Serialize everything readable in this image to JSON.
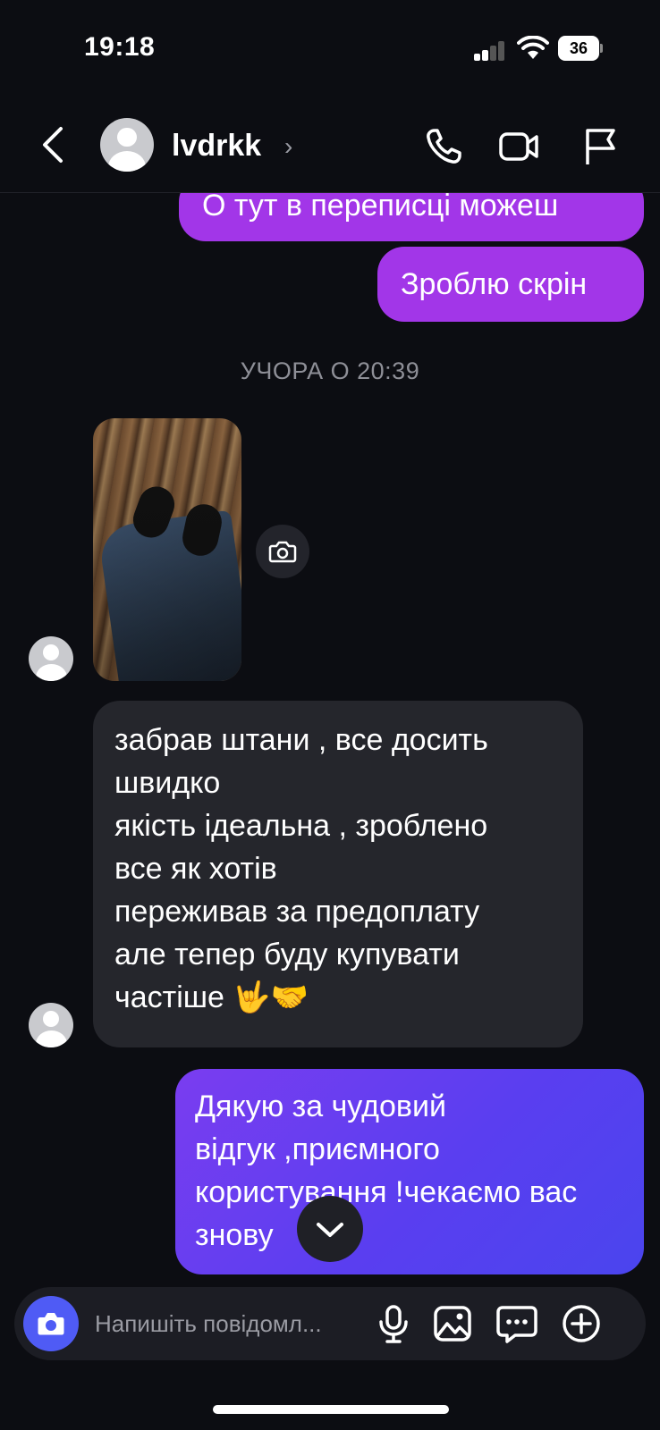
{
  "status_bar": {
    "time": "19:18",
    "battery": "36"
  },
  "header": {
    "username": "lvdrkk",
    "chevron": "›"
  },
  "messages": {
    "out1": "О тут в переписці можеш",
    "out2": "Зроблю скрін",
    "timestamp": "УЧОРА О 20:39",
    "in_text_lines": [
      "забрав штани , все досить",
      "швидко",
      "якість ідеальна , зроблено",
      "все як хотів",
      "переживав за предоплату",
      "але тепер буду купувати",
      "частіше 🤟🤝"
    ],
    "reply_lines": [
      "Дякую за чудовий",
      "відгук ,приємного",
      "користування !чекаємо вас",
      "знову"
    ]
  },
  "composer": {
    "placeholder": "Напишіть повідомл..."
  },
  "colors": {
    "background": "#0c0d12",
    "outgoing_purple": "#a236e8",
    "incoming_bubble": "#25262c",
    "reply_gradient_start": "#7a3df0",
    "reply_gradient_end": "#4a45ee",
    "composer_camera": "#4f5bf5"
  },
  "icons": {
    "header": [
      "back-icon",
      "phone-icon",
      "video-icon",
      "flag-icon"
    ],
    "composer": [
      "camera-icon",
      "microphone-icon",
      "image-icon",
      "sticker-icon",
      "plus-icon"
    ]
  }
}
